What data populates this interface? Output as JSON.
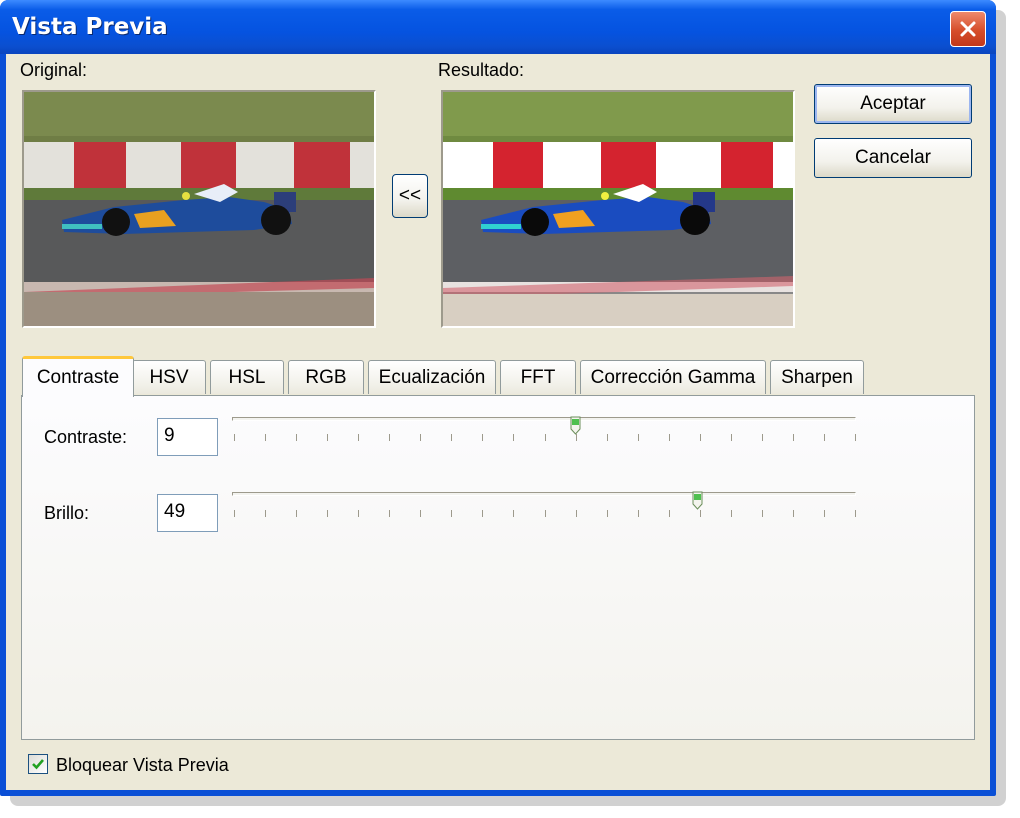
{
  "window": {
    "title": "Vista Previa"
  },
  "preview": {
    "original_label": "Original:",
    "result_label": "Resultado:",
    "copy_button": "<<"
  },
  "buttons": {
    "accept": "Aceptar",
    "cancel": "Cancelar"
  },
  "tabs": [
    {
      "label": "Contraste",
      "active": true
    },
    {
      "label": "HSV",
      "active": false
    },
    {
      "label": "HSL",
      "active": false
    },
    {
      "label": "RGB",
      "active": false
    },
    {
      "label": "Ecualización",
      "active": false
    },
    {
      "label": "FFT",
      "active": false
    },
    {
      "label": "Corrección Gamma",
      "active": false
    },
    {
      "label": "Sharpen",
      "active": false
    }
  ],
  "controls": {
    "contrast": {
      "label": "Contraste:",
      "value": "9",
      "slider_fraction": 0.55
    },
    "brightness": {
      "label": "Brillo:",
      "value": "49",
      "slider_fraction": 0.745
    }
  },
  "lock_preview": {
    "label": "Bloquear Vista Previa",
    "checked": true
  },
  "colors": {
    "titlebar": "#0553e0",
    "face": "#ece9d8",
    "accent_tab": "#ffc83c"
  },
  "icons": {
    "close": "close-icon",
    "checkbox": "check-icon",
    "slider_thumb": "slider-thumb-icon"
  }
}
